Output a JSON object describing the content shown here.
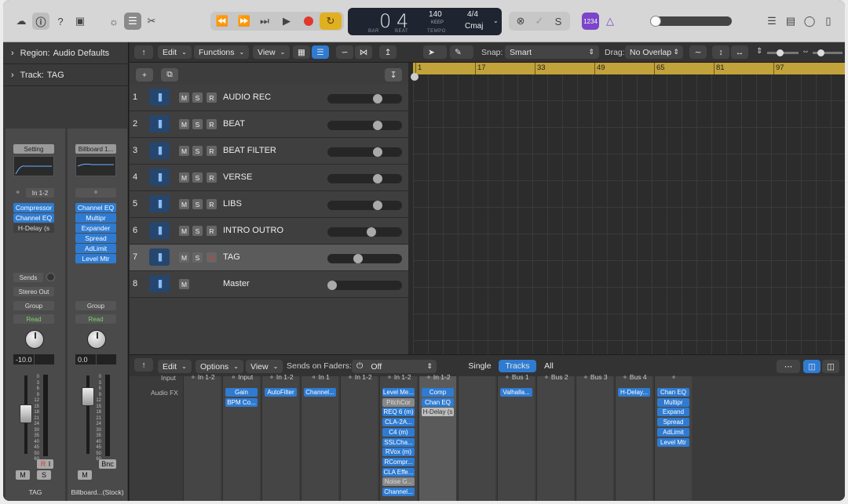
{
  "transport": {
    "bar": "0",
    "beat": "4",
    "bar_caption": "BAR",
    "beat_caption": "BEAT",
    "tempo": "140",
    "keep": "KEEP",
    "tempo_caption": "TEMPO",
    "signature": "4/4",
    "key": "Cmaj",
    "count_in": "1234"
  },
  "inspector": {
    "region_label": "Region:",
    "region_value": "Audio Defaults",
    "track_label": "Track:",
    "track_value": "TAG",
    "strip1": {
      "setting": "Setting",
      "input": "In 1-2",
      "plugins": [
        "Compressor",
        "Channel EQ",
        "H-Delay (s"
      ],
      "sends": "Sends",
      "output": "Stereo Out",
      "group": "Group",
      "automation": "Read",
      "volume": "-10.0",
      "mute": "M",
      "solo": "S",
      "rec": "R",
      "input_mon": "I",
      "name": "TAG"
    },
    "strip2": {
      "setting": "Billboard 1...",
      "plugins": [
        "Channel EQ",
        "Multipr",
        "Expander",
        "Spread",
        "AdLimit",
        "Level Mtr"
      ],
      "group": "Group",
      "automation": "Read",
      "volume": "0.0",
      "bounce": "Bnc",
      "mute": "M",
      "name": "Billboard...(Stock)"
    },
    "scale": [
      "0",
      "3",
      "6",
      "9",
      "12",
      "15",
      "18",
      "21",
      "24",
      "30",
      "35",
      "40",
      "45",
      "50",
      "60"
    ]
  },
  "tracks_toolbar": {
    "edit": "Edit",
    "functions": "Functions",
    "view": "View",
    "snap_label": "Snap:",
    "snap_value": "Smart",
    "drag_label": "Drag:",
    "drag_value": "No Overlap"
  },
  "tracks": [
    {
      "num": "1",
      "name": "AUDIO REC",
      "mute": "M",
      "solo": "S",
      "rec": "R",
      "volume": 0.7
    },
    {
      "num": "2",
      "name": "BEAT",
      "mute": "M",
      "solo": "S",
      "rec": "R",
      "volume": 0.7
    },
    {
      "num": "3",
      "name": "BEAT FILTER",
      "mute": "M",
      "solo": "S",
      "rec": "R",
      "volume": 0.7
    },
    {
      "num": "4",
      "name": "VERSE",
      "mute": "M",
      "solo": "S",
      "rec": "R",
      "volume": 0.7
    },
    {
      "num": "5",
      "name": "LIBS",
      "mute": "M",
      "solo": "S",
      "rec": "R",
      "volume": 0.7
    },
    {
      "num": "6",
      "name": "INTRO OUTRO",
      "mute": "M",
      "solo": "S",
      "rec": "R",
      "volume": 0.6
    },
    {
      "num": "7",
      "name": "TAG",
      "mute": "M",
      "solo": "S",
      "rec": "R",
      "volume": 0.4
    },
    {
      "num": "8",
      "name": "Master",
      "mute": "M",
      "solo": "",
      "rec": "",
      "volume": 0.0
    }
  ],
  "ruler": [
    "1",
    "17",
    "33",
    "49",
    "65",
    "81",
    "97"
  ],
  "mixer_toolbar": {
    "edit": "Edit",
    "options": "Options",
    "view": "View",
    "sends_label": "Sends on Faders:",
    "sends_value": "Off",
    "single": "Single",
    "tracks": "Tracks",
    "all": "All"
  },
  "mixer": {
    "input_label": "Input",
    "audio_fx_label": "Audio FX",
    "columns": [
      {
        "input": "In 1-2",
        "plugins": []
      },
      {
        "input": "Input",
        "plugins": [
          "Gain",
          "BPM Co..."
        ]
      },
      {
        "input": "In 1-2",
        "plugins": [
          "AutoFilter"
        ]
      },
      {
        "input": "In 1",
        "plugins": [
          "Channel..."
        ]
      },
      {
        "input": "In 1-2",
        "plugins": []
      },
      {
        "input": "In 1-2",
        "plugins": [
          "Level Me...",
          "PitchCor",
          "REQ 6 (m)",
          "CLA-2A...",
          "C4 (m)",
          "SSLCha...",
          "RVox (m)",
          "RCompr...",
          "CLA Effe...",
          "Noise G...",
          "Channel..."
        ]
      },
      {
        "input": "In 1-2",
        "plugins": [
          "Comp",
          "Chan EQ",
          "H-Delay (s"
        ]
      },
      {
        "input": "",
        "plugins": []
      },
      {
        "input": "Bus 1",
        "plugins": [
          "Valhalla..."
        ]
      },
      {
        "input": "Bus 2",
        "plugins": []
      },
      {
        "input": "Bus 3",
        "plugins": []
      },
      {
        "input": "Bus 4",
        "plugins": [
          "H-Delay..."
        ]
      },
      {
        "input": "",
        "plugins": [
          "Chan EQ",
          "Multipr",
          "Expand",
          "Spread",
          "AdLimit",
          "Level Mtr"
        ]
      }
    ]
  },
  "colors": {
    "accent_blue": "#2f7bd1",
    "ruler_gold": "#c2a23a",
    "cycle_yellow": "#e0b022",
    "record_red": "#e0392b",
    "count_in_purple": "#7b45c9"
  }
}
